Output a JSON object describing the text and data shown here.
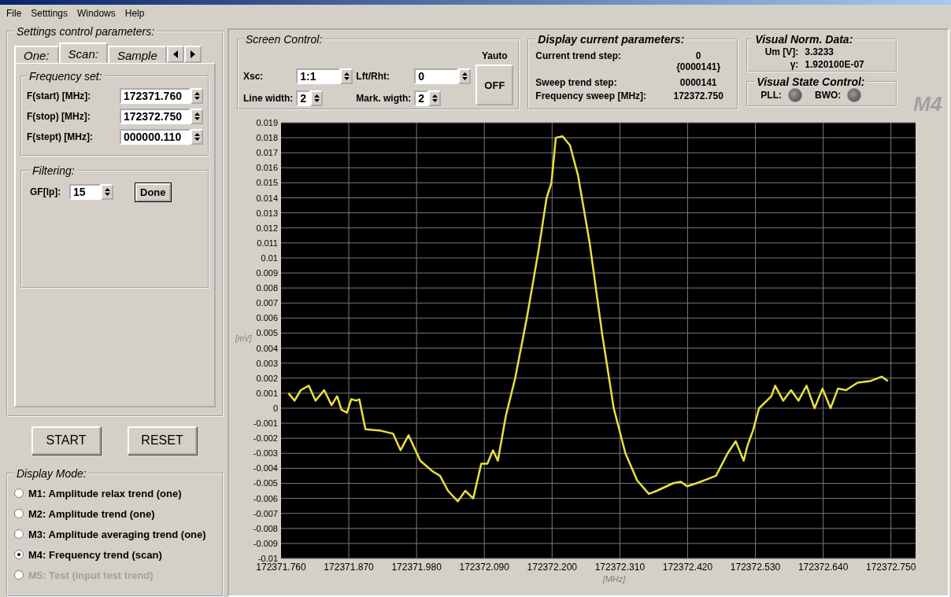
{
  "menu": [
    "File",
    "Setttings",
    "Windows",
    "Help"
  ],
  "settings_panel": {
    "title": "Settings control parameters:",
    "tabs": [
      {
        "label": "One:",
        "selected": false
      },
      {
        "label": "Scan:",
        "selected": true
      },
      {
        "label": "Sample",
        "selected": false
      }
    ],
    "frequency_set": {
      "title": "Frequency set:",
      "fields": [
        {
          "label": "F(start) [MHz]:",
          "value": "172371.760"
        },
        {
          "label": "F(stop) [MHz]:",
          "value": "172372.750"
        },
        {
          "label": "F(stept) [MHz]:",
          "value": "000000.110"
        }
      ]
    },
    "filtering": {
      "title": "Filtering:",
      "label": "GF[lp]:",
      "value": "15",
      "button": "Done"
    }
  },
  "buttons": [
    "START",
    "RESET"
  ],
  "display_mode": {
    "title": "Display Mode:",
    "options": [
      {
        "label": "M1: Amplitude relax trend (one)",
        "selected": false,
        "disabled": false
      },
      {
        "label": "M2: Amplitude trend (one)",
        "selected": false,
        "disabled": false
      },
      {
        "label": "M3: Amplitude averaging trend (one)",
        "selected": false,
        "disabled": false
      },
      {
        "label": "M4: Frequency trend (scan)",
        "selected": true,
        "disabled": false
      },
      {
        "label": "M5: Test (input test trend)",
        "selected": false,
        "disabled": true
      }
    ]
  },
  "screen_control": {
    "title": "Screen Control:",
    "fields": [
      {
        "label": "Xsc:",
        "value": "1:1"
      },
      {
        "label": "Lft/Rht:",
        "value": "0"
      },
      {
        "label": "Line width:",
        "value": "2"
      },
      {
        "label": "Mark. wigth:",
        "value": "2"
      }
    ],
    "yauto_label": "Yauto",
    "yauto_button": "OFF"
  },
  "current_params": {
    "title": "Display current parameters:",
    "rows": [
      {
        "label": "Current trend step:",
        "values": [
          "0",
          "{0000141}"
        ]
      },
      {
        "label": "Sweep trend step:",
        "values": [
          "0000141"
        ]
      },
      {
        "label": "Frequency sweep [MHz]:",
        "values": [
          "172372.750"
        ]
      }
    ]
  },
  "norm_data": {
    "title": "Visual Norm. Data:",
    "rows": [
      {
        "label": "Um [V]:",
        "value": "3.3233"
      },
      {
        "label": "γ:",
        "value": "1.920100E-07"
      }
    ]
  },
  "state_control": {
    "title": "Visual State Control:",
    "indicators": [
      {
        "label": "PLL:",
        "on": false
      },
      {
        "label": "BWO:",
        "on": false
      }
    ]
  },
  "mode_badge": "M4",
  "chart_data": {
    "type": "line",
    "grid": true,
    "xlabel": "[MHz]",
    "ylabel": "[mV]",
    "x": [
      172371.772,
      172371.782,
      172371.792,
      172371.805,
      172371.816,
      172371.83,
      172371.842,
      172371.851,
      172371.858,
      172371.867,
      172371.874,
      172371.882,
      172371.887,
      172371.897,
      172371.922,
      172371.942,
      172371.954,
      172371.967,
      172371.986,
      172372.006,
      172372.018,
      172372.031,
      172372.047,
      172372.059,
      172372.072,
      172372.085,
      172372.095,
      172372.104,
      172372.112,
      172372.125,
      172372.14,
      172372.159,
      172372.178,
      172372.191,
      172372.199,
      172372.206,
      172372.217,
      172372.229,
      172372.242,
      172372.261,
      172372.281,
      172372.3,
      172372.319,
      172372.338,
      172372.357,
      172372.37,
      172372.396,
      172372.409,
      172372.419,
      172372.434,
      172372.453,
      172372.466,
      172372.485,
      172372.498,
      172372.511,
      172372.517,
      172372.526,
      172372.536,
      172372.556,
      172372.562,
      172372.575,
      172372.588,
      172372.6,
      172372.613,
      172372.626,
      172372.639,
      172372.652,
      172372.664,
      172372.677,
      172372.696,
      172372.716,
      172372.735,
      172372.745
    ],
    "series": [
      {
        "color": "#e8e040",
        "values": [
          0.001,
          0.0005,
          0.0012,
          0.0015,
          0.0005,
          0.0012,
          0.0002,
          0.0008,
          -0.0001,
          -0.0003,
          0.0006,
          0.0005,
          0.0006,
          -0.0014,
          -0.0015,
          -0.0017,
          -0.0028,
          -0.0018,
          -0.0035,
          -0.0042,
          -0.0045,
          -0.0055,
          -0.0062,
          -0.0055,
          -0.006,
          -0.0037,
          -0.0037,
          -0.0028,
          -0.0035,
          -0.0005,
          0.002,
          0.006,
          0.0105,
          0.014,
          0.015,
          0.018,
          0.0181,
          0.0175,
          0.0155,
          0.011,
          0.005,
          0.0,
          -0.003,
          -0.0048,
          -0.0057,
          -0.0055,
          -0.005,
          -0.0049,
          -0.0052,
          -0.005,
          -0.0047,
          -0.0045,
          -0.003,
          -0.0022,
          -0.0035,
          -0.0025,
          -0.0015,
          0.0,
          0.0008,
          0.0015,
          0.0005,
          0.0012,
          0.0005,
          0.0015,
          0.0,
          0.0013,
          0.0,
          0.0013,
          0.0012,
          0.0017,
          0.0018,
          0.0021,
          0.0018
        ]
      }
    ],
    "xlim": [
      172371.76,
      172372.79
    ],
    "ylim": [
      -0.01,
      0.019
    ],
    "xticks": [
      {
        "value": 172371.76,
        "label": "172371.760"
      },
      {
        "value": 172371.87,
        "label": "172371.870"
      },
      {
        "value": 172371.98,
        "label": "172371.980"
      },
      {
        "value": 172372.09,
        "label": "172372.090"
      },
      {
        "value": 172372.2,
        "label": "172372.200"
      },
      {
        "value": 172372.31,
        "label": "172372.310"
      },
      {
        "value": 172372.42,
        "label": "172372.420"
      },
      {
        "value": 172372.53,
        "label": "172372.530"
      },
      {
        "value": 172372.64,
        "label": "172372.640"
      },
      {
        "value": 172372.75,
        "label": "172372.750"
      }
    ],
    "yticks": [
      0.019,
      0.018,
      0.017,
      0.016,
      0.015,
      0.014,
      0.013,
      0.012,
      0.011,
      0.01,
      0.009,
      0.008,
      0.007,
      0.006,
      0.005,
      0.004,
      0.003,
      0.002,
      0.001,
      0,
      -0.001,
      -0.002,
      -0.003,
      -0.004,
      -0.005,
      -0.006,
      -0.007,
      -0.008,
      -0.009,
      -0.01
    ]
  }
}
